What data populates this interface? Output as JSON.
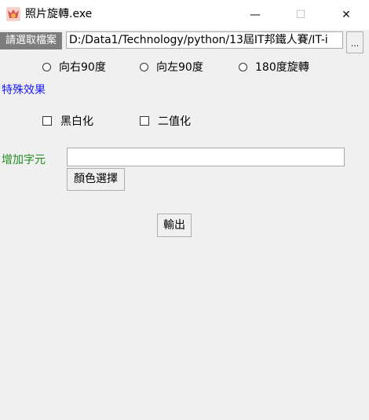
{
  "window": {
    "title": "照片旋轉.exe",
    "icon": "app-icon",
    "controls": {
      "minimize": "—",
      "maximize": "☐",
      "close": "✕"
    }
  },
  "file": {
    "label": "請選取檔案",
    "path": "D:/Data1/Technology/python/13屆IT邦鐵人賽/IT-i",
    "browse_label": "..."
  },
  "rotation": {
    "options": [
      {
        "label": "向右90度",
        "selected": false
      },
      {
        "label": "向左90度",
        "selected": false
      },
      {
        "label": "180度旋轉",
        "selected": false
      }
    ]
  },
  "effects": {
    "heading": "特殊效果",
    "heading_color": "#1a1aff",
    "options": [
      {
        "label": "黑白化",
        "checked": false
      },
      {
        "label": "二值化",
        "checked": false
      }
    ]
  },
  "text": {
    "label": "增加字元",
    "label_color": "#1e8c1e",
    "value": "",
    "color_button": "顏色選擇"
  },
  "output_button": "輸出"
}
